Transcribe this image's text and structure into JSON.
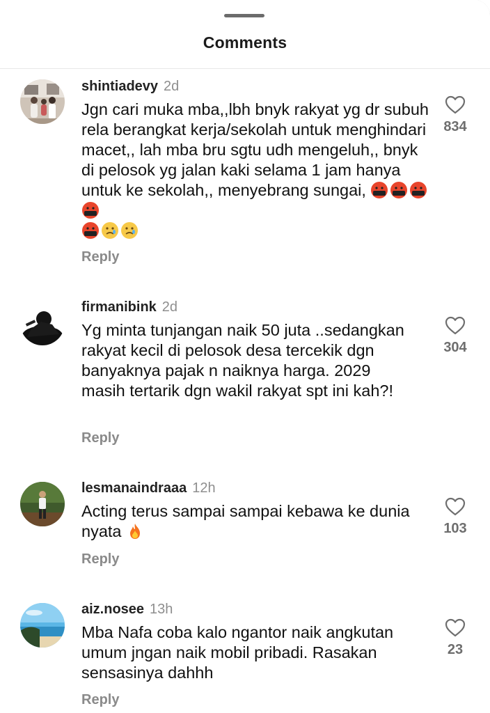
{
  "header": {
    "title": "Comments"
  },
  "comments": [
    {
      "username": "shintiadevy",
      "time": "2d",
      "text": "Jgn cari muka mba,,lbh bnyk rakyat yg dr subuh rela berangkat kerja/sekolah untuk menghindari macet,, lah mba bru sgtu udh mengeluh,, bnyk di pelosok yg jalan kaki selama 1 jam hanya untuk ke sekolah,, menyebrang sungai,",
      "emojis": [
        "cursing-face-icon",
        "cursing-face-icon",
        "cursing-face-icon",
        "cursing-face-icon",
        "cursing-face-icon",
        "crying-face-icon",
        "crying-face-icon"
      ],
      "likes": "834",
      "reply_label": "Reply"
    },
    {
      "username": "firmanibink",
      "time": "2d",
      "text": "Yg minta tunjangan naik 50 juta ..sedangkan rakyat kecil di pelosok desa tercekik dgn banyaknya pajak n naiknya harga.  2029 masih tertarik dgn wakil rakyat spt ini kah?!",
      "likes": "304",
      "reply_label": "Reply"
    },
    {
      "username": "lesmanaindraaa",
      "time": "12h",
      "text": "Acting terus sampai sampai kebawa ke dunia nyata",
      "emojis": [
        "fire-icon"
      ],
      "likes": "103",
      "reply_label": "Reply"
    },
    {
      "username": "aiz.nosee",
      "time": "13h",
      "text": "Mba Nafa coba kalo ngantor naik angkutan umum jngan naik mobil pribadi. Rasakan sensasinya dahhh",
      "likes": "23",
      "reply_label": "Reply"
    }
  ]
}
